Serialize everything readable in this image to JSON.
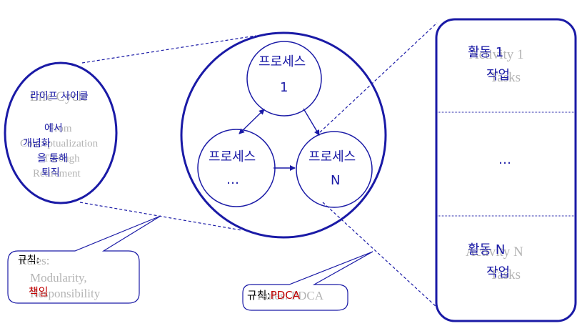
{
  "colors": {
    "stroke": "#1a1aa6",
    "text_primary": "#1a1aa6",
    "text_ghost": "#b4b4b4",
    "accent_red": "#c00000"
  },
  "lifecycle": {
    "lines": [
      "라이프 사이클",
      "에서",
      "개념화",
      "을 통해",
      "퇴직"
    ],
    "ghost_lines": [
      "Life Cycle",
      "From",
      "Conceptualization",
      "Through",
      "Retirement"
    ]
  },
  "processes": {
    "p1": {
      "label": "프로세스",
      "index": "1"
    },
    "pdots": {
      "label": "프로세스",
      "index": "…"
    },
    "pn": {
      "label": "프로세스",
      "index": "N"
    }
  },
  "activities": {
    "top": {
      "line1": "활동 1",
      "line2": "작업",
      "ghost1": "Activity 1",
      "ghost2": "Tasks"
    },
    "middle": {
      "text": "…"
    },
    "bottom": {
      "line1": "활동 N",
      "line2": "작업",
      "ghost1": "Activity N",
      "ghost2": "Tasks"
    }
  },
  "callouts": {
    "left": {
      "title": "규칙:",
      "ghost_title": "Rules:",
      "ghost1": "Modularity,",
      "ghost2": "Responsibility",
      "item": "책임"
    },
    "right": {
      "prefix": "규칙:",
      "item": "PDCA",
      "ghost": "Rules: PDCA"
    }
  }
}
